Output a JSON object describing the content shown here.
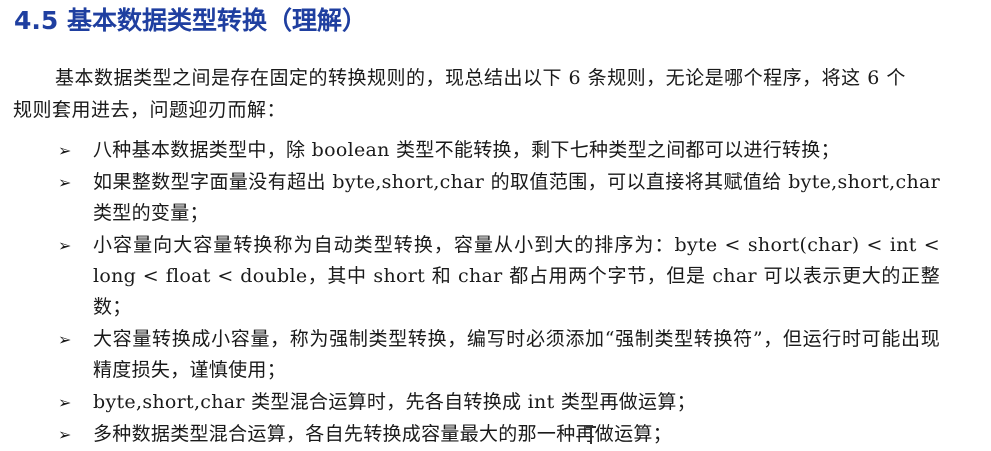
{
  "heading": "4.5 基本数据类型转换（理解）",
  "intro": "基本数据类型之间是存在固定的转换规则的，现总结出以下 6 条规则，无论是哪个程序，将这 6 个规则套用进去，问题迎刃而解：",
  "bullet_symbol": "➢",
  "rules": [
    "八种基本数据类型中，除 boolean 类型不能转换，剩下七种类型之间都可以进行转换；",
    "如果整数型字面量没有超出 byte,short,char 的取值范围，可以直接将其赋值给 byte,short,char 类型的变量；",
    "小容量向大容量转换称为自动类型转换，容量从小到大的排序为：byte < short(char) < int < long < float < double，其中 short 和 char 都占用两个字节，但是 char 可以表示更大的正整数；",
    "大容量转换成小容量，称为强制类型转换，编写时必须添加“强制类型转换符”，但运行时可能出现精度损失，谨慎使用；",
    "byte,short,char 类型混合运算时，先各自转换成 int 类型再做运算；",
    "多种数据类型混合运算，各自先转换成容量最大的那一种再做运算；"
  ]
}
